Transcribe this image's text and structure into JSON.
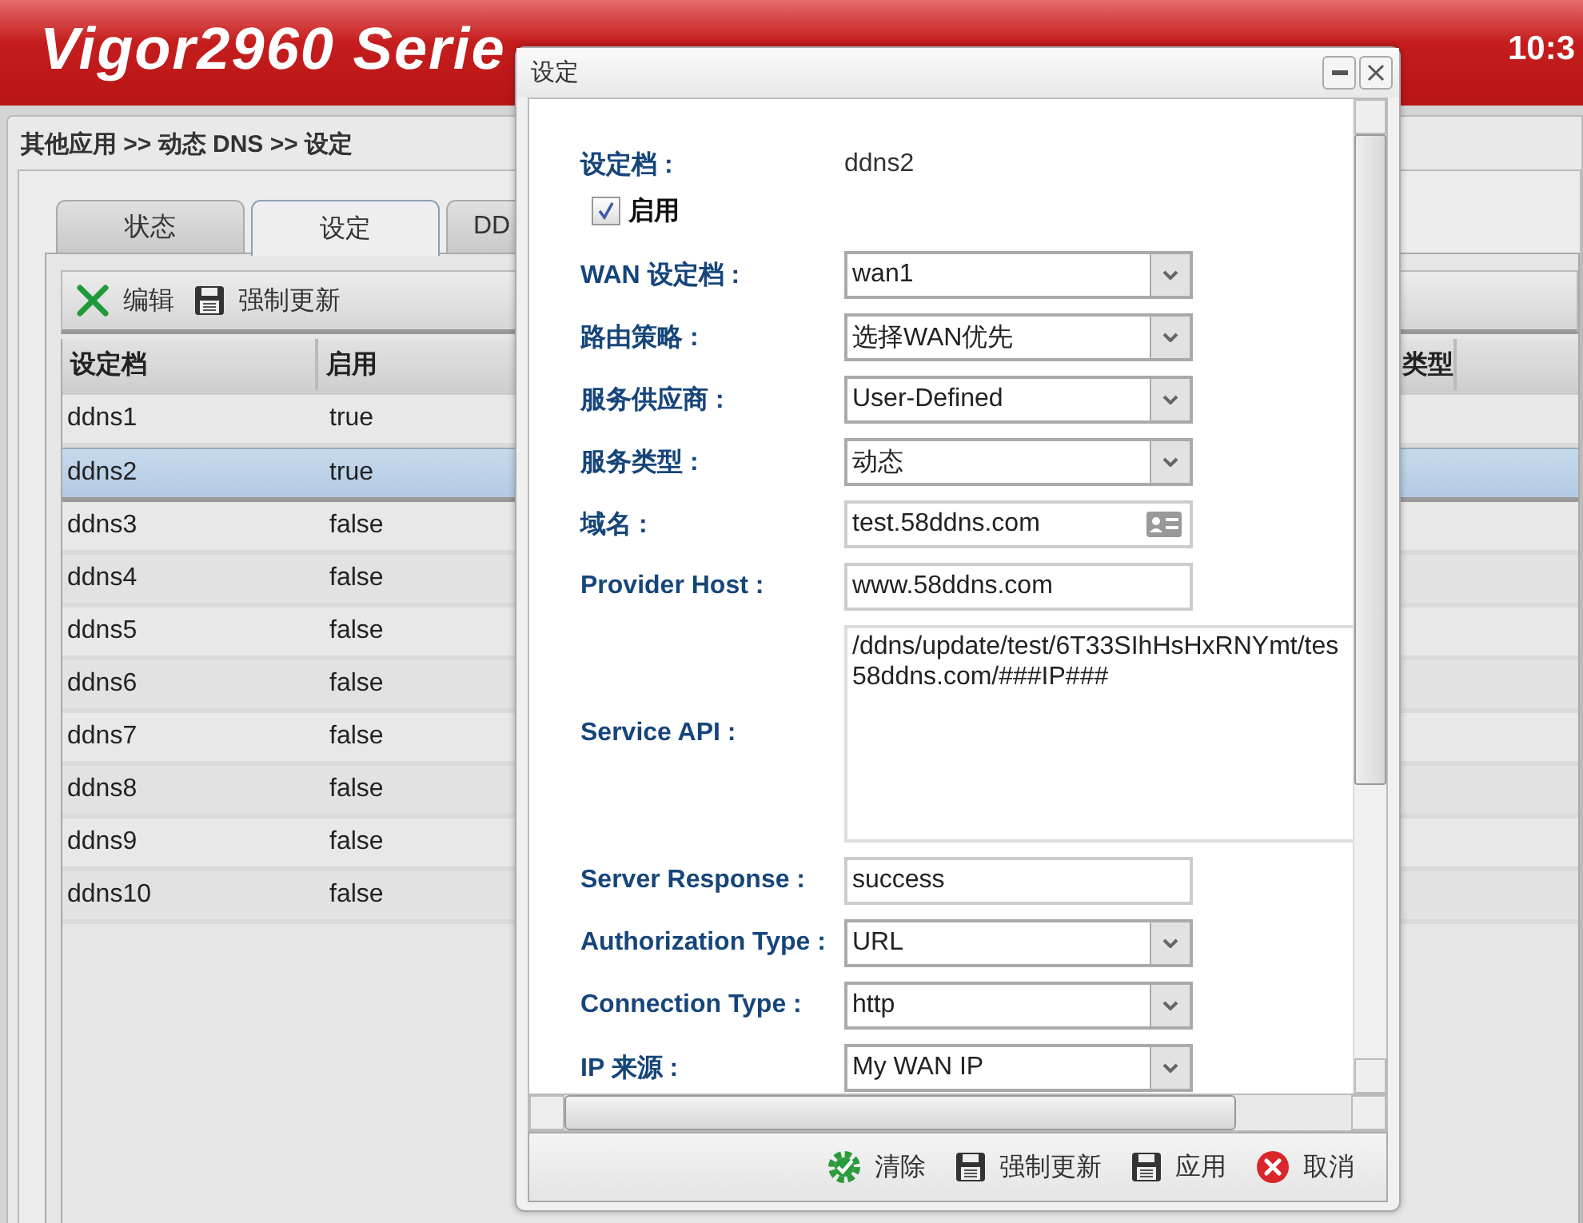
{
  "header": {
    "logo": "Vigor2960 Serie",
    "time": "10:3"
  },
  "breadcrumb": "其他应用 >> 动态 DNS >> 设定",
  "tabs": [
    {
      "label": "状态",
      "selected": false
    },
    {
      "label": "设定",
      "selected": true
    },
    {
      "label": "DD",
      "selected": false
    }
  ],
  "toolbar": [
    {
      "label": "编辑"
    },
    {
      "label": "强制更新"
    }
  ],
  "table": {
    "columns": [
      "设定档",
      "启用",
      "类型"
    ],
    "rows": [
      {
        "cells": [
          "ddns1",
          "true"
        ],
        "selected": false
      },
      {
        "cells": [
          "ddns2",
          "true"
        ],
        "selected": true
      },
      {
        "cells": [
          "ddns3",
          "false"
        ],
        "selected": false
      },
      {
        "cells": [
          "ddns4",
          "false"
        ],
        "selected": false
      },
      {
        "cells": [
          "ddns5",
          "false"
        ],
        "selected": false
      },
      {
        "cells": [
          "ddns6",
          "false"
        ],
        "selected": false
      },
      {
        "cells": [
          "ddns7",
          "false"
        ],
        "selected": false
      },
      {
        "cells": [
          "ddns8",
          "false"
        ],
        "selected": false
      },
      {
        "cells": [
          "ddns9",
          "false"
        ],
        "selected": false
      },
      {
        "cells": [
          "ddns10",
          "false"
        ],
        "selected": false
      }
    ]
  },
  "dialog": {
    "title": "设定",
    "fields": [
      {
        "kind": "text",
        "label": "设定档 :",
        "value": "ddns2"
      },
      {
        "kind": "checkbox",
        "label": "启用",
        "checked": true
      },
      {
        "kind": "select",
        "label": "WAN 设定档 :",
        "value": "wan1"
      },
      {
        "kind": "select",
        "label": "路由策略 :",
        "value": "选择WAN优先"
      },
      {
        "kind": "select",
        "label": "服务供应商 :",
        "value": "User-Defined"
      },
      {
        "kind": "select",
        "label": "服务类型 :",
        "value": "动态"
      },
      {
        "kind": "input_icon",
        "label": "域名 :",
        "value": "test.58ddns.com"
      },
      {
        "kind": "input",
        "label": "Provider Host :",
        "value": "www.58ddns.com"
      },
      {
        "kind": "textarea",
        "label": "Service API :",
        "lines": [
          "/ddns/update/test/6T33SIhHsHxRNYmt/tes",
          "58ddns.com/###IP###"
        ]
      },
      {
        "kind": "input",
        "label": "Server Response :",
        "value": "success"
      },
      {
        "kind": "select",
        "label": "Authorization Type :",
        "value": "URL"
      },
      {
        "kind": "select",
        "label": "Connection Type :",
        "value": "http"
      },
      {
        "kind": "select",
        "label": "IP 来源 :",
        "value": "My WAN IP"
      }
    ],
    "buttons": [
      {
        "label": "清除"
      },
      {
        "label": "强制更新"
      },
      {
        "label": "应用"
      },
      {
        "label": "取消"
      }
    ]
  }
}
